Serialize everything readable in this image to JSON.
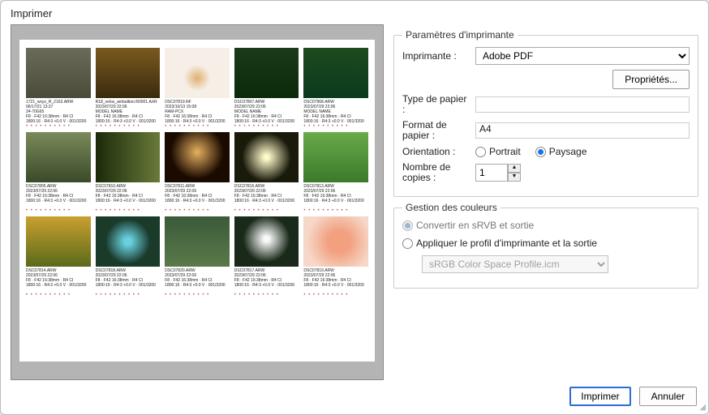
{
  "title": "Imprimer",
  "printerSettings": {
    "legend": "Paramètres d'imprimante",
    "printerLabel": "Imprimante :",
    "printerValue": "Adobe PDF",
    "propertiesLabel": "Propriétés...",
    "paperTypeLabel": "Type de papier :",
    "paperTypeValue": "",
    "paperSizeLabel": "Format de papier :",
    "paperSizeValue": "A4",
    "orientationLabel": "Orientation :",
    "portraitLabel": "Portrait",
    "landscapeLabel": "Paysage",
    "orientation": "landscape",
    "copiesLabel": "Nombre de copies :",
    "copiesValue": "1"
  },
  "colorMgmt": {
    "legend": "Gestion des couleurs",
    "convertLabel": "Convertir en sRVB et sortie",
    "applyLabel": "Appliquer le profil d'imprimante et la sortie",
    "selected": "convert",
    "profileValue": "sRGB Color Space Profile.icm"
  },
  "buttons": {
    "print": "Imprimer",
    "cancel": "Annuler"
  },
  "thumbs": [
    {
      "bg": "linear-gradient(#6b6b5a,#4b4b3a)",
      "l1": "1721_wxyz_R_2163.ARW",
      "l2": "06/17/21 13:37",
      "l3": "24-70G65",
      "l4": "F8 · F42 16:38mm · R4 CI",
      "l5": "1800:16 · R4:3 +0.0 V · 001/3200"
    },
    {
      "bg": "linear-gradient(#7a5a1e,#3a2a0e)",
      "l1": "R18_velox_ambuttion:R0001.AXR",
      "l2": "2023/07/29 22:06",
      "l3": "MODEL NAME",
      "l4": "F8 · F42 16:38mm · R4 CI",
      "l5": "1800:16 · R4:3 +0.0 V · 001/3200"
    },
    {
      "bg": "radial-gradient(circle at 50% 60%, #e0b070 0%, #f6efe7 30%, #f6efe7 100%)",
      "l1": "DSC07819.NF",
      "l2": "2023/10/13 15:08",
      "l3": "RAM-PCX",
      "l4": "F8 · F42 16:38mm · R4 CI",
      "l5": "1800:16 · R4:3 +0.0 V · 001/3200"
    },
    {
      "bg": "linear-gradient(#1a3a1a,#0a2a0a)",
      "l1": "DSC07807.ARW",
      "l2": "2023/07/29 22:06",
      "l3": "MODEL NAME",
      "l4": "F8 · F42 16:38mm · R4 CI",
      "l5": "1800:16 · R4:3 +0.0 V · 001/3200"
    },
    {
      "bg": "linear-gradient(#1e4a1e,#0a3a1e)",
      "l1": "DSC07968.ARW",
      "l2": "2023/07/29 22:06",
      "l3": "MODEL NAME",
      "l4": "F8 · F42 16:38mm · R4 CI",
      "l5": "1800:16 · R4:3 +0.0 V · 001/3200"
    },
    {
      "bg": "linear-gradient(#7a8a5a,#3a4a2a)",
      "l1": "DSC07805.ARW",
      "l2": "2023/07/29 22:06",
      "l3": "F8 · F42 16:38mm · R4 CI",
      "l4": "1800:16 · R4:3 +0.0 V · 001/3200",
      "l5": ""
    },
    {
      "bg": "linear-gradient(90deg,#1a2a0a,#6a7a3a)",
      "l1": "DSC07810.ARW",
      "l2": "2023/07/29 22:06",
      "l3": "F8 · F42 16:38mm · R4 CI",
      "l4": "1800:16 · R4:3 +0.0 V · 001/3200",
      "l5": ""
    },
    {
      "bg": "radial-gradient(circle at 50% 40%, #e6b060 0%, #1a0a00 60%)",
      "l1": "DSC07811.ARW",
      "l2": "2023/07/29 22:06",
      "l3": "F8 · F42 16:38mm · R4 CI",
      "l4": "1800:16 · R4:3 +0.0 V · 001/3200",
      "l5": ""
    },
    {
      "bg": "radial-gradient(circle,#fefacb 5%,#1a1a0a 60%)",
      "l1": "DSC07816.ARW",
      "l2": "2023/07/29 22:06",
      "l3": "F8 · F42 16:38mm · R4 CI",
      "l4": "1800:16 · R4:3 +0.0 V · 001/3200",
      "l5": ""
    },
    {
      "bg": "linear-gradient(#6aaa4a,#3a7a2a)",
      "l1": "DSC07813.ARW",
      "l2": "2023/07/29 22:06",
      "l3": "F8 · F42 16:38mm · R4 CI",
      "l4": "1800:16 · R4:3 +0.0 V · 001/3200",
      "l5": ""
    },
    {
      "bg": "linear-gradient(#caa030,#5a6a1a)",
      "l1": "DSC07814.ARW",
      "l2": "2023/07/29 22:06",
      "l3": "F8 · F42 16:38mm · R4 CI",
      "l4": "1800:16 · R4:3 +0.0 V · 001/3200",
      "l5": ""
    },
    {
      "bg": "radial-gradient(circle,#6ad0e0 8%,#1a3a2a 55%)",
      "l1": "DSC07818.ARW",
      "l2": "2023/07/29 22:06",
      "l3": "F8 · F42 16:38mm · R4 CI",
      "l4": "1800:16 · R4:3 +0.0 V · 001/3200",
      "l5": ""
    },
    {
      "bg": "linear-gradient(#3a5a3a,#5a7a4a)",
      "l1": "DSC07820.ARW",
      "l2": "2023/07/29 22:06",
      "l3": "F8 · F42 16:38mm · R4 CI",
      "l4": "1800:16 · R4:3 +0.0 V · 001/3200",
      "l5": ""
    },
    {
      "bg": "radial-gradient(circle at 50% 45%,#fafafa 6%,#1a2a1a 55%)",
      "l1": "DSC07817.ARW",
      "l2": "2023/07/29 22:06",
      "l3": "F8 · F42 16:38mm · R4 CI",
      "l4": "1800:16 · R4:3 +0.0 V · 001/3200",
      "l5": ""
    },
    {
      "bg": "radial-gradient(circle at 55% 50%,#f2a080 25%,#f6d8c8 75%)",
      "l1": "DSC07819.ARW",
      "l2": "2023/07/29 22:06",
      "l3": "F8 · F42 16:38mm · R4 CI",
      "l4": "1800:16 · R4:3 +0.0 V · 001/3200",
      "l5": ""
    }
  ],
  "dots": "• • • • • • • • • •"
}
